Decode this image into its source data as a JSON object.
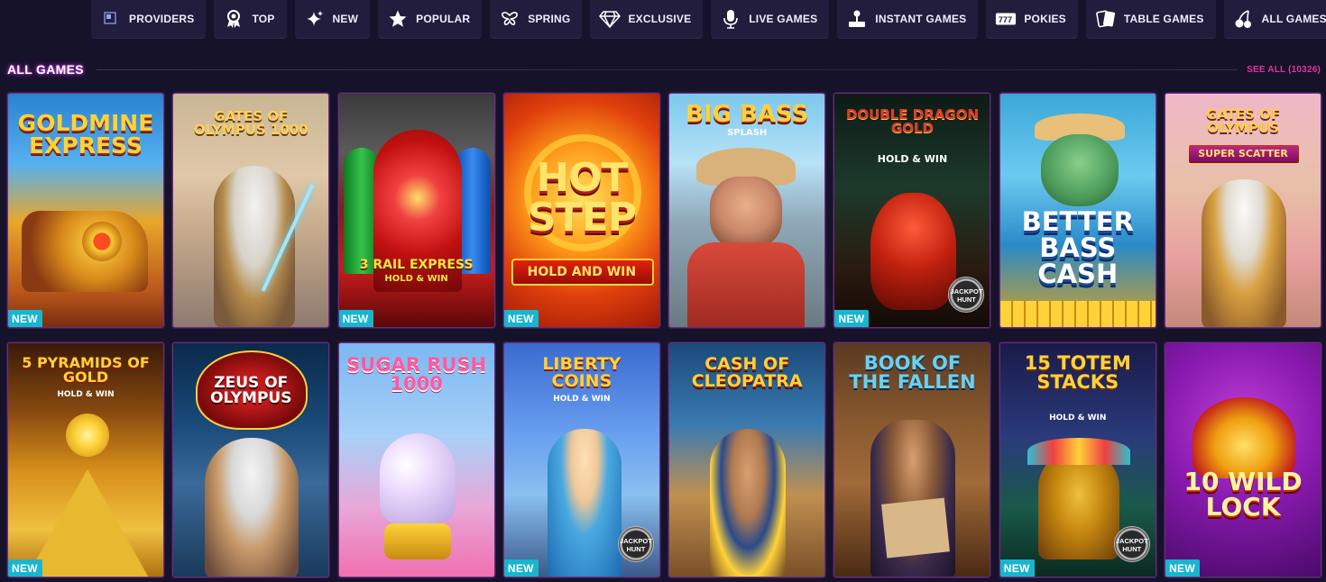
{
  "categories": [
    {
      "label": "PROVIDERS",
      "icon": "providers-icon"
    },
    {
      "label": "TOP",
      "icon": "award-icon"
    },
    {
      "label": "NEW",
      "icon": "sparkle-icon"
    },
    {
      "label": "POPULAR",
      "icon": "star-icon"
    },
    {
      "label": "SPRING",
      "icon": "butterfly-icon"
    },
    {
      "label": "EXCLUSIVE",
      "icon": "diamond-icon"
    },
    {
      "label": "LIVE GAMES",
      "icon": "microphone-icon"
    },
    {
      "label": "INSTANT GAMES",
      "icon": "joystick-icon"
    },
    {
      "label": "POKIES",
      "icon": "slot-777-icon"
    },
    {
      "label": "TABLE GAMES",
      "icon": "cards-icon"
    },
    {
      "label": "ALL GAMES",
      "icon": "cherries-icon"
    }
  ],
  "section": {
    "title": "ALL GAMES",
    "see_all": "SEE ALL (10326)"
  },
  "badges": {
    "new": "NEW",
    "jackpot_line1": "JACKPOT",
    "jackpot_line2": "HUNT"
  },
  "games": [
    {
      "title": "GOLDMINE EXPRESS",
      "sub": "",
      "new": true,
      "jackpot": false
    },
    {
      "title": "GATES OF OLYMPUS 1000",
      "sub": "",
      "new": false,
      "jackpot": false
    },
    {
      "title": "3 RAIL EXPRESS",
      "sub": "HOLD & WIN",
      "new": true,
      "jackpot": false
    },
    {
      "title": "HOT STEP",
      "sub": "HOLD AND WIN",
      "new": true,
      "jackpot": false
    },
    {
      "title": "BIG BASS",
      "sub": "SPLASH",
      "new": false,
      "jackpot": false
    },
    {
      "title": "DOUBLE DRAGON GOLD",
      "sub": "HOLD & WIN",
      "new": true,
      "jackpot": true
    },
    {
      "title": "BETTER BASS CASH",
      "sub": "",
      "new": false,
      "jackpot": false
    },
    {
      "title": "GATES OF OLYMPUS",
      "sub": "SUPER SCATTER",
      "new": false,
      "jackpot": false
    },
    {
      "title": "5 PYRAMIDS OF GOLD",
      "sub": "HOLD & WIN",
      "new": true,
      "jackpot": false
    },
    {
      "title": "ZEUS OF OLYMPUS",
      "sub": "",
      "new": false,
      "jackpot": false
    },
    {
      "title": "SUGAR RUSH 1000",
      "sub": "",
      "new": false,
      "jackpot": false
    },
    {
      "title": "LIBERTY COINS",
      "sub": "HOLD & WIN",
      "new": true,
      "jackpot": true
    },
    {
      "title": "CASH OF CLEOPATRA",
      "sub": "",
      "new": false,
      "jackpot": false
    },
    {
      "title": "BOOK OF THE FALLEN",
      "sub": "",
      "new": false,
      "jackpot": false
    },
    {
      "title": "15 TOTEM STACKS",
      "sub": "HOLD & WIN",
      "new": true,
      "jackpot": true
    },
    {
      "title": "10 WILD LOCK",
      "sub": "",
      "new": true,
      "jackpot": false
    }
  ]
}
